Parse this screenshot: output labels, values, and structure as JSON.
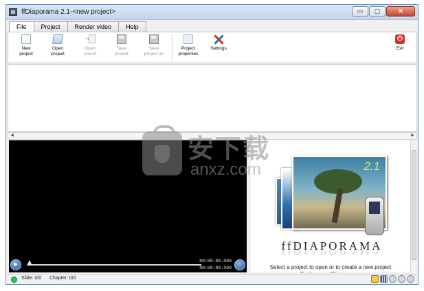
{
  "window": {
    "title": "ffDiaporama 2.1-<new project>",
    "controls": {
      "minimize": "▭",
      "maximize": "▢",
      "close": "✕"
    }
  },
  "tabs": [
    {
      "label": "File",
      "active": true
    },
    {
      "label": "Project",
      "active": false
    },
    {
      "label": "Render video",
      "active": false
    },
    {
      "label": "Help",
      "active": false
    }
  ],
  "ribbon": {
    "new_project": {
      "line1": "New",
      "line2": "project",
      "icon": "new-document-icon",
      "enabled": true
    },
    "open_project": {
      "line1": "Open",
      "line2": "project",
      "icon": "open-folder-icon",
      "enabled": true
    },
    "open_recent": {
      "line1": "Open",
      "line2": "recent",
      "icon": "recent-files-icon",
      "enabled": false
    },
    "save_project": {
      "line1": "Save",
      "line2": "project",
      "icon": "floppy-disk-icon",
      "enabled": false
    },
    "save_project_as": {
      "line1": "Save",
      "line2": "project as",
      "icon": "floppy-disk-as-icon",
      "enabled": false
    },
    "project_properties": {
      "line1": "Project",
      "line2": "properties",
      "icon": "properties-icon",
      "enabled": true
    },
    "settings": {
      "label": "Settings",
      "icon": "tools-icon",
      "enabled": true
    },
    "exit": {
      "label": "Exit",
      "icon": "power-icon",
      "enabled": true
    }
  },
  "player": {
    "time_current": "00:00:00.000",
    "time_total": "00:00:00.000",
    "position": 0.0
  },
  "preview": {
    "version": "2.1",
    "brand": "ffDIAPORAMA",
    "hint_line1": "Select a project to open or to create a new project",
    "hint_line2": "To discover ffDiaporama:"
  },
  "status": {
    "slide": "Slide: 0/0",
    "chapter": "Chapter: 0/0",
    "indicator_color": "#21c94b"
  },
  "watermark": {
    "text_cn": "安下载",
    "text_en": "anxz.com"
  },
  "colors": {
    "accent": "#1c4d9a",
    "exit_red": "#d6322a",
    "version_yellow": "#d7e957"
  }
}
